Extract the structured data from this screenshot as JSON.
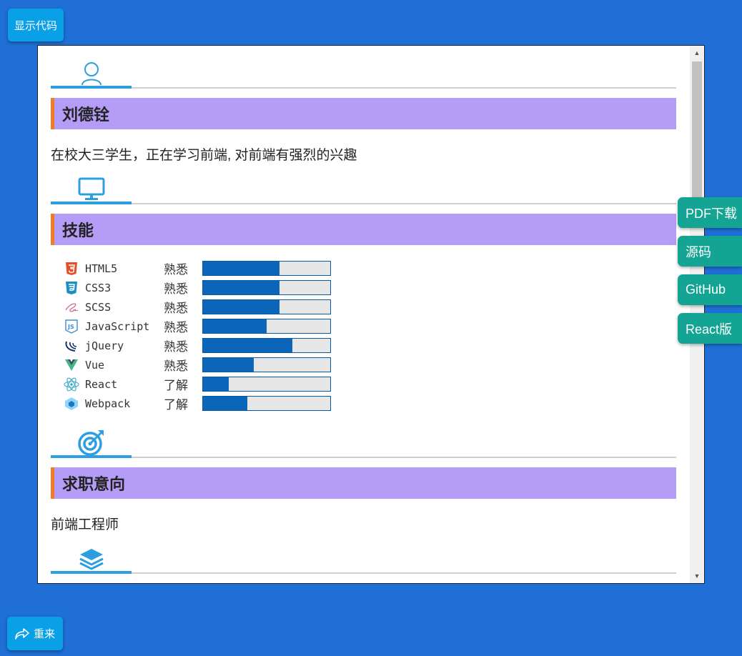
{
  "toolbar": {
    "show_code_label": "显示代码",
    "restart_label": "重来"
  },
  "resume": {
    "name": "刘德铨",
    "intro": "在校大三学生，正在学习前端, 对前端有强烈的兴趣",
    "skills_title": "技能",
    "skills": [
      {
        "icon": "html5-icon",
        "name": "HTML5",
        "level": "熟悉",
        "percent": 60
      },
      {
        "icon": "css3-icon",
        "name": "CSS3",
        "level": "熟悉",
        "percent": 60
      },
      {
        "icon": "sass-icon",
        "name": "SCSS",
        "level": "熟悉",
        "percent": 60
      },
      {
        "icon": "javascript-icon",
        "name": "JavaScript",
        "level": "熟悉",
        "percent": 50
      },
      {
        "icon": "jquery-icon",
        "name": "jQuery",
        "level": "熟悉",
        "percent": 70
      },
      {
        "icon": "vue-icon",
        "name": "Vue",
        "level": "熟悉",
        "percent": 40
      },
      {
        "icon": "react-icon",
        "name": "React",
        "level": "了解",
        "percent": 20
      },
      {
        "icon": "webpack-icon",
        "name": "Webpack",
        "level": "了解",
        "percent": 35
      }
    ],
    "job_title": "求职意向",
    "job": "前端工程师"
  },
  "side_links": [
    {
      "label": "PDF下载"
    },
    {
      "label": "源码"
    },
    {
      "label": "GitHub"
    },
    {
      "label": "React版"
    }
  ],
  "colors": {
    "background": "#1f6fd6",
    "title_bar": "#b59cf7",
    "title_accent": "#f07b25",
    "section_accent": "#2d9fe0",
    "side_button": "#13a493",
    "bar_fill": "#0b65b8"
  }
}
